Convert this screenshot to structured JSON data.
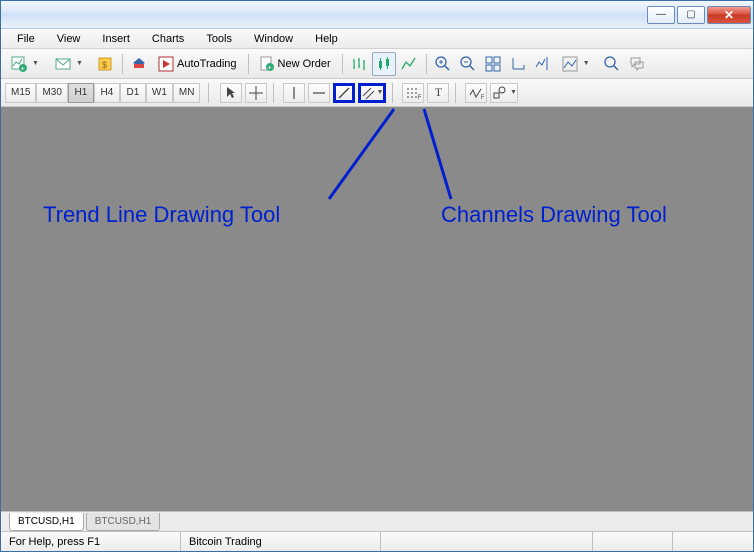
{
  "menu": {
    "file": "File",
    "view": "View",
    "insert": "Insert",
    "charts": "Charts",
    "tools": "Tools",
    "window": "Window",
    "help": "Help"
  },
  "toolbar": {
    "autotrading": "AutoTrading",
    "neworder": "New Order"
  },
  "timeframes": {
    "m15": "M15",
    "m30": "M30",
    "h1": "H1",
    "h4": "H4",
    "d1": "D1",
    "w1": "W1",
    "mn": "MN"
  },
  "annotations": {
    "trend": "Trend Line Drawing Tool",
    "channels": "Channels Drawing Tool"
  },
  "tabs": {
    "active": "BTCUSD,H1",
    "inactive": "BTCUSD,H1"
  },
  "status": {
    "help": "For Help, press F1",
    "title": "Bitcoin Trading"
  },
  "tools2": {
    "text": "T",
    "f1": "F",
    "f2": "F"
  }
}
